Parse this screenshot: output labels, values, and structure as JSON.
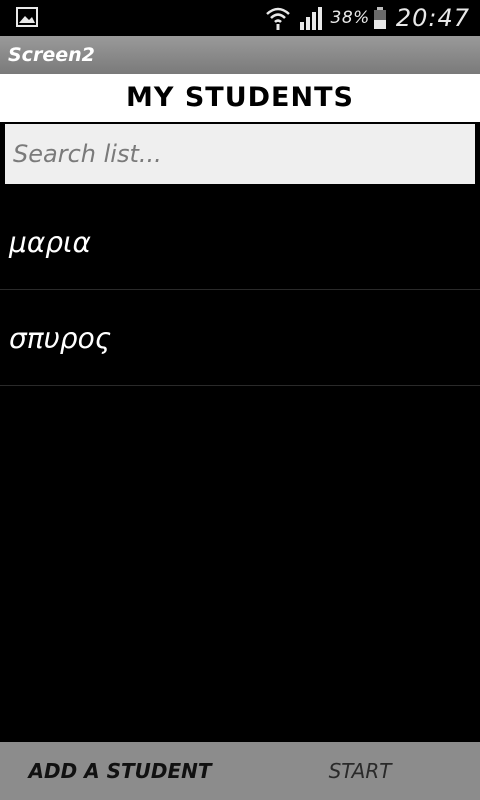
{
  "status_bar": {
    "battery_percent": "38%",
    "time": "20:47"
  },
  "app": {
    "title": "Screen2"
  },
  "header": {
    "title": "MY STUDENTS"
  },
  "search": {
    "placeholder": "Search list..."
  },
  "students": [
    "μαρια",
    "σπυρος"
  ],
  "bottom_bar": {
    "add_label": "ADD A STUDENT",
    "start_label": "START"
  },
  "colors": {
    "background": "#000000",
    "title_bar": "#8a8a8a",
    "bottom_bar": "#8c8c8c",
    "search_field": "#efefef"
  }
}
